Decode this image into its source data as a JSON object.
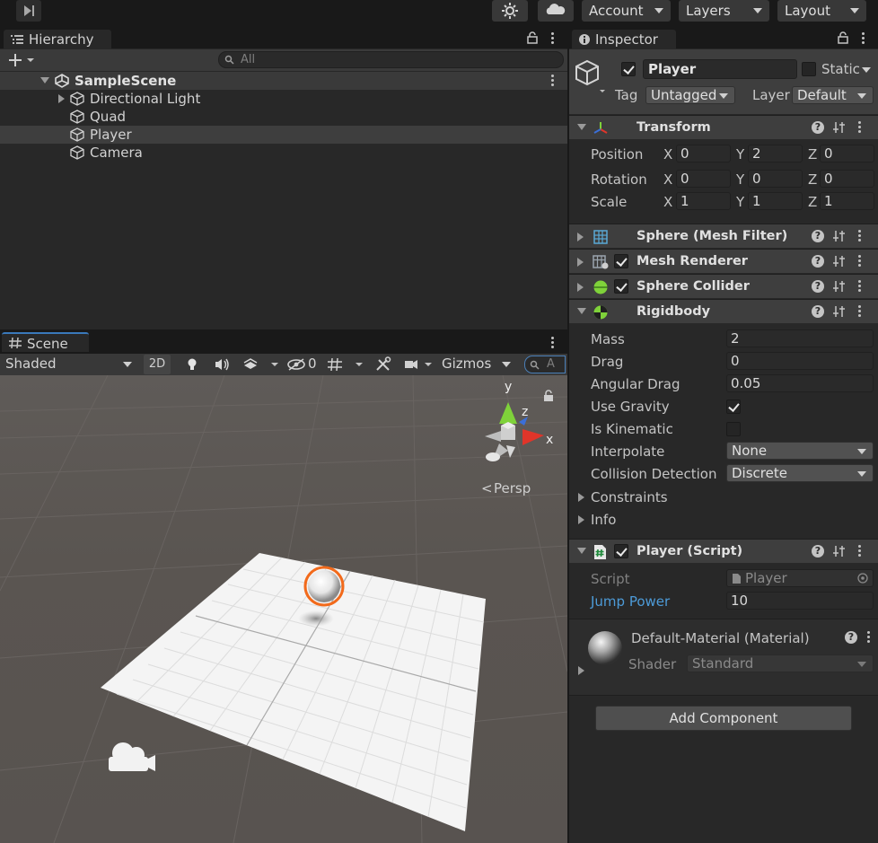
{
  "toolbar": {
    "account_label": "Account",
    "layers_label": "Layers",
    "layout_label": "Layout"
  },
  "hierarchy": {
    "tab_label": "Hierarchy",
    "search_placeholder": "All",
    "scene_name": "SampleScene",
    "items": [
      {
        "label": "Directional Light"
      },
      {
        "label": "Quad"
      },
      {
        "label": "Player"
      },
      {
        "label": "Camera"
      }
    ]
  },
  "scene": {
    "tab_label": "Scene",
    "shading_mode": "Shaded",
    "mode_2d": "2D",
    "hidden_count": "0",
    "gizmos_label": "Gizmos",
    "search_placeholder": "A",
    "gizmo_y": "y",
    "gizmo_z": "z",
    "gizmo_x": "x",
    "projection_label": "Persp"
  },
  "inspector": {
    "tab_label": "Inspector",
    "object_name": "Player",
    "static_label": "Static",
    "tag_label": "Tag",
    "tag_value": "Untagged",
    "layer_label": "Layer",
    "layer_value": "Default",
    "transform": {
      "title": "Transform",
      "position_label": "Position",
      "rotation_label": "Rotation",
      "scale_label": "Scale",
      "axis_x": "X",
      "axis_y": "Y",
      "axis_z": "Z",
      "position": {
        "x": "0",
        "y": "2",
        "z": "0"
      },
      "rotation": {
        "x": "0",
        "y": "0",
        "z": "0"
      },
      "scale": {
        "x": "1",
        "y": "1",
        "z": "1"
      }
    },
    "mesh_filter": {
      "title": "Sphere (Mesh Filter)"
    },
    "mesh_renderer": {
      "title": "Mesh Renderer"
    },
    "sphere_collider": {
      "title": "Sphere Collider"
    },
    "rigidbody": {
      "title": "Rigidbody",
      "mass_label": "Mass",
      "mass": "2",
      "drag_label": "Drag",
      "drag": "0",
      "angular_drag_label": "Angular Drag",
      "angular_drag": "0.05",
      "use_gravity_label": "Use Gravity",
      "is_kinematic_label": "Is Kinematic",
      "interpolate_label": "Interpolate",
      "interpolate": "None",
      "collision_label": "Collision Detection",
      "collision": "Discrete",
      "constraints_label": "Constraints",
      "info_label": "Info"
    },
    "player_script": {
      "title": "Player (Script)",
      "script_label": "Script",
      "script_value": "Player",
      "jump_power_label": "Jump Power",
      "jump_power": "10"
    },
    "material": {
      "title": "Default-Material (Material)",
      "shader_label": "Shader",
      "shader_value": "Standard"
    },
    "add_component_label": "Add Component"
  },
  "colors": {
    "accent_link": "#4d9bd8",
    "selection_outline": "#f26a1b",
    "panel_bg": "#282828",
    "header_bg": "#3e3e3e"
  }
}
